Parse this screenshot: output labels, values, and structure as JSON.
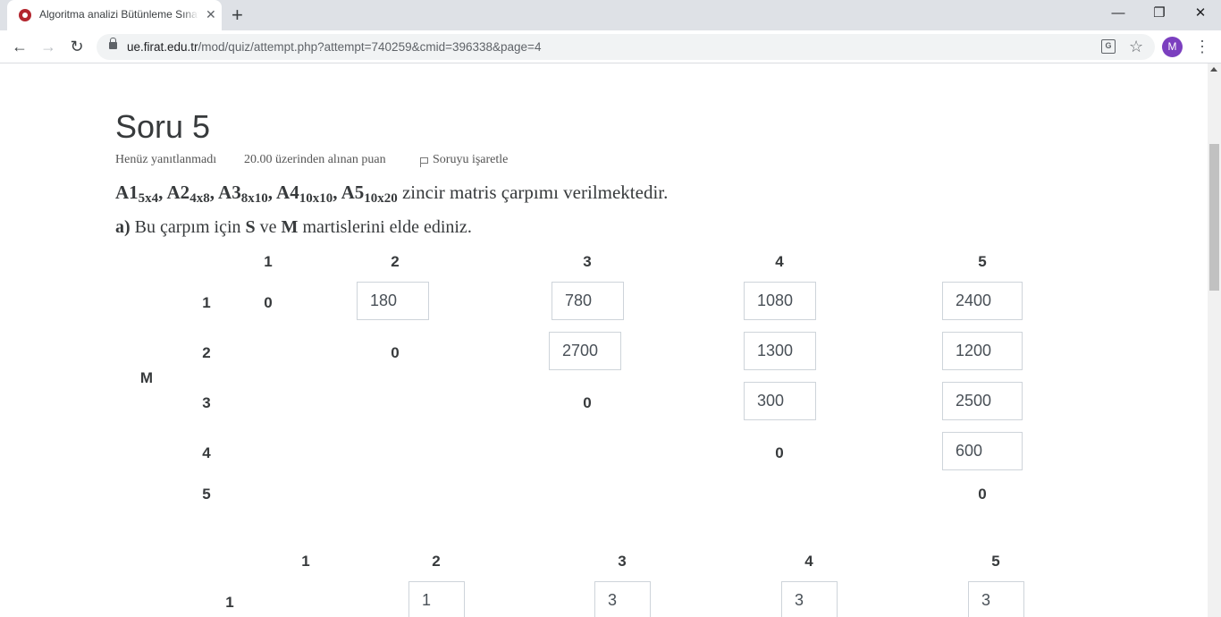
{
  "browser": {
    "tab_title": "Algoritma analizi Bütünleme Sınavı",
    "tab_close": "✕",
    "new_tab": "+",
    "window_minimize": "—",
    "window_restore": "❐",
    "window_close": "✕",
    "back": "←",
    "forward": "→",
    "reload": "↻",
    "url_host": "ue.firat.edu.tr",
    "url_path": "/mod/quiz/attempt.php?attempt=740259&cmid=396338&page=4",
    "avatar_letter": "M",
    "menu": "⋮",
    "star": "☆",
    "translate": "G"
  },
  "question": {
    "title": "Soru 5",
    "status": "Henüz yanıtlanmadı",
    "points": "20.00 üzerinden alınan puan",
    "flag_label": "Soruyu işaretle",
    "matrices": [
      {
        "name": "A1",
        "dim": "5x4"
      },
      {
        "name": "A2",
        "dim": "4x8"
      },
      {
        "name": "A3",
        "dim": "8x10"
      },
      {
        "name": "A4",
        "dim": "10x10"
      },
      {
        "name": "A5",
        "dim": "10x20"
      }
    ],
    "intro_tail": "zincir matris çarpımı verilmektedir.",
    "part_label": "a)",
    "part_text_1": "Bu çarpım için",
    "part_S": "S",
    "part_ve": "ve",
    "part_M": "M",
    "part_text_2": "martislerini elde ediniz."
  },
  "m_table": {
    "label": "M",
    "col_headers": [
      "1",
      "2",
      "3",
      "4",
      "5"
    ],
    "row_headers": [
      "1",
      "2",
      "3",
      "4",
      "5"
    ],
    "diagonal": [
      "0",
      "0",
      "0",
      "0",
      "0"
    ],
    "inputs": {
      "r1": [
        "180",
        "780",
        "1080",
        "2400"
      ],
      "r2": [
        "2700",
        "1300",
        "1200"
      ],
      "r3": [
        "300",
        "2500"
      ],
      "r4": [
        "600"
      ]
    }
  },
  "s_table": {
    "col_headers": [
      "1",
      "2",
      "3",
      "4",
      "5"
    ],
    "row_headers": [
      "1"
    ],
    "inputs": {
      "r1": [
        "1",
        "3",
        "3",
        "3"
      ]
    }
  }
}
